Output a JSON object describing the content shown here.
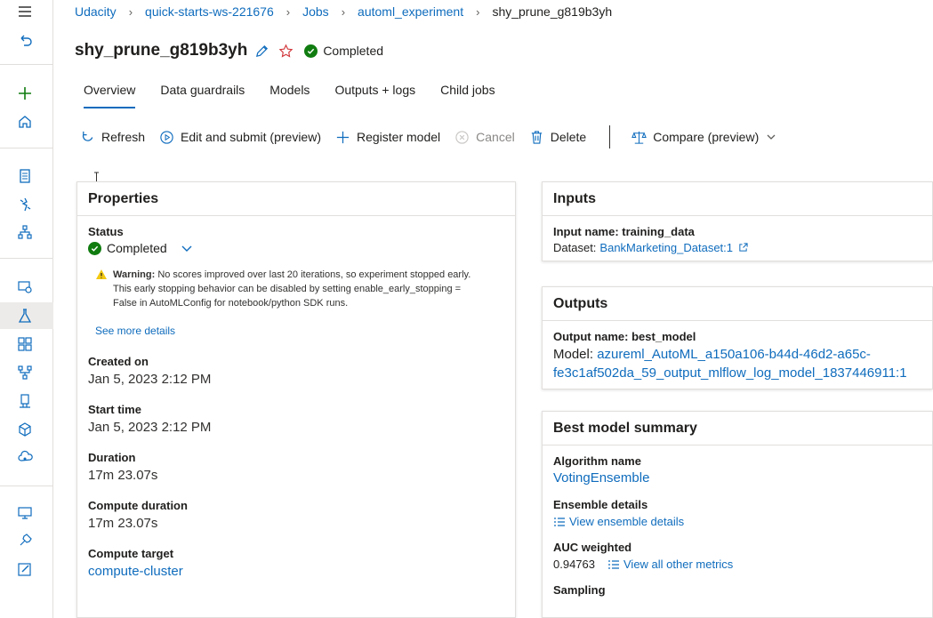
{
  "breadcrumb": {
    "items": [
      "Udacity",
      "quick-starts-ws-221676",
      "Jobs",
      "automl_experiment"
    ],
    "current": "shy_prune_g819b3yh"
  },
  "title": {
    "name": "shy_prune_g819b3yh",
    "status": "Completed"
  },
  "tabs": [
    "Overview",
    "Data guardrails",
    "Models",
    "Outputs + logs",
    "Child jobs"
  ],
  "toolbar": {
    "refresh": "Refresh",
    "edit_submit": "Edit and submit (preview)",
    "register": "Register model",
    "cancel": "Cancel",
    "delete": "Delete",
    "compare": "Compare (preview)"
  },
  "properties": {
    "heading": "Properties",
    "status_label": "Status",
    "status_value": "Completed",
    "warning_title": "Warning:",
    "warning_line1": "No scores improved over last 20 iterations, so experiment stopped early.",
    "warning_line2": "This early stopping behavior can be disabled by setting enable_early_stopping =",
    "warning_line3": "False in AutoMLConfig for notebook/python SDK runs.",
    "see_more": "See more details",
    "created_label": "Created on",
    "created_value": "Jan 5, 2023 2:12 PM",
    "start_label": "Start time",
    "start_value": "Jan 5, 2023 2:12 PM",
    "duration_label": "Duration",
    "duration_value": "17m 23.07s",
    "compute_duration_label": "Compute duration",
    "compute_duration_value": "17m 23.07s",
    "compute_target_label": "Compute target",
    "compute_target_value": "compute-cluster"
  },
  "inputs": {
    "heading": "Inputs",
    "name_line": "Input name: training_data",
    "dataset_label": "Dataset:",
    "dataset_value": "BankMarketing_Dataset:1"
  },
  "outputs": {
    "heading": "Outputs",
    "name_line": "Output name: best_model",
    "model_label": "Model:",
    "model_value_line1": "azureml_AutoML_a150a106-b44d-46d2-a65c-",
    "model_value_line2": "fe3c1af502da_59_output_mlflow_log_model_1837446911:1"
  },
  "best_model": {
    "heading": "Best model summary",
    "algorithm_label": "Algorithm name",
    "algorithm_value": "VotingEnsemble",
    "ensemble_label": "Ensemble details",
    "ensemble_link": "View ensemble details",
    "auc_label": "AUC weighted",
    "auc_value": "0.94763",
    "metrics_link": "View all other metrics",
    "sampling_label": "Sampling"
  },
  "colors": {
    "accent": "#0f6cbd",
    "success": "#107c10",
    "warning": "#f2c811",
    "favorite": "#d13438"
  }
}
